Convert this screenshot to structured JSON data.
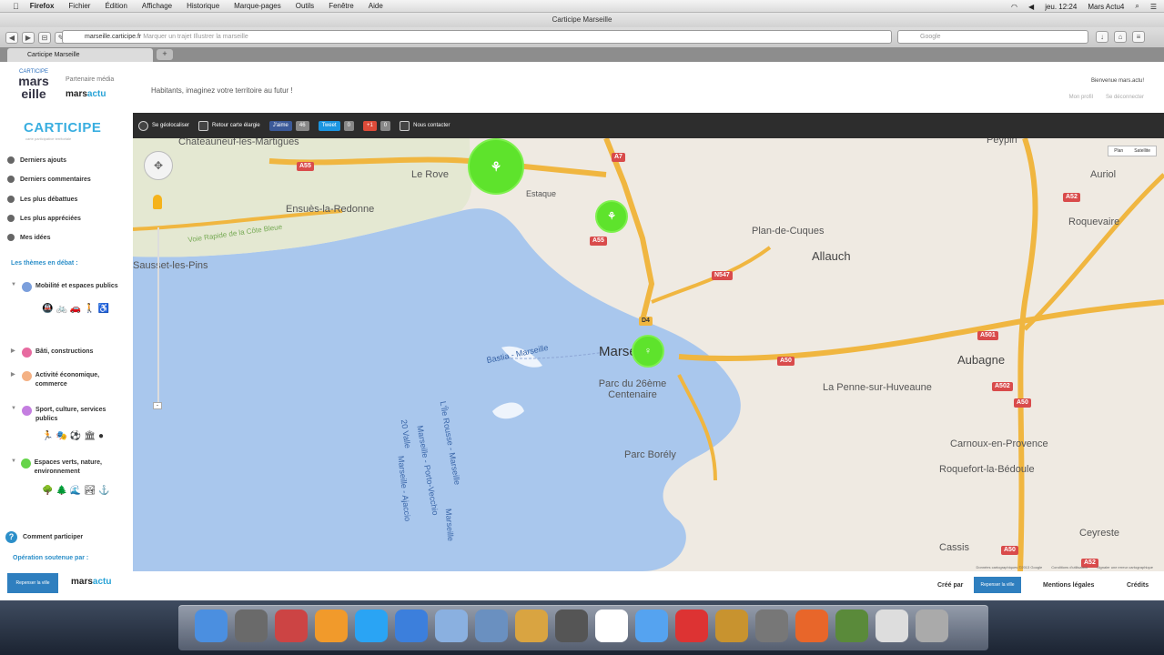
{
  "os_menubar": {
    "app": "Firefox",
    "menus": [
      "Fichier",
      "Édition",
      "Affichage",
      "Historique",
      "Marque-pages",
      "Outils",
      "Fenêtre",
      "Aide"
    ],
    "clock": "jeu. 12:24",
    "user": "Mars Actu4"
  },
  "browser": {
    "window_title": "Carticipe Marseille",
    "url_host": "marseille.carticipe.fr",
    "url_rest": " Marquer un trajet Illustrer la marseille",
    "search_engine": "Google",
    "tab_title": "Carticipe Marseille"
  },
  "header": {
    "logo_top": "CARTICIPE",
    "logo_main1": "mars",
    "logo_main2": "eille",
    "partner_label": "Partenaire média",
    "partner_name": "mars",
    "partner_name_accent": "actu",
    "tagline": "Habitants, imaginez votre territoire au futur !",
    "welcome": "Bienvenue mars.actu!",
    "user_links": [
      "Mon profil",
      "Se déconnecter"
    ]
  },
  "sidebar": {
    "brand": "CARTICIPE",
    "brand_sub": "carte participative territoriale",
    "nav": [
      "Derniers ajouts",
      "Derniers commentaires",
      "Les plus débattues",
      "Les plus appréciées",
      "Mes idées"
    ],
    "themes_title": "Les thèmes en débat :",
    "themes": [
      {
        "label": "Mobilité et espaces publics",
        "color": "#7b9fdc",
        "icons": "🚇🚲🚗🚶♿"
      },
      {
        "label": "Bâti, constructions",
        "color": "#e76ba0",
        "icons": ""
      },
      {
        "label": "Activité économique, commerce",
        "color": "#f4b184",
        "icons": ""
      },
      {
        "label": "Sport, culture, services publics",
        "color": "#c47ee0",
        "icons": "🏃🎭⚽🏛●"
      },
      {
        "label": "Espaces verts, nature, environnement",
        "color": "#66d44a",
        "icons": "🌳🌲🌊🏞⚓"
      }
    ],
    "help": "Comment participer",
    "support_label": "Opération soutenue par :",
    "footer_logo_text": "Repenser la ville",
    "footer_partner": "mars",
    "footer_partner_accent": "actu"
  },
  "map_toolbar": {
    "geoloc": "Se géolocaliser",
    "back": "Retour carte élargie",
    "like": "J'aime",
    "like_count": "46",
    "tweet": "Tweet",
    "tweet_count": "0",
    "gplus": "+1",
    "gplus_count": "0",
    "contact": "Nous contacter"
  },
  "map": {
    "maptype": [
      "Plan",
      "Satellite"
    ],
    "cities": [
      {
        "name": "Chateauneuf-les-Martigues",
        "cls": "city"
      },
      {
        "name": "Le Rove",
        "cls": "city"
      },
      {
        "name": "Ensuès-la-Redonne",
        "cls": "city"
      },
      {
        "name": "Sausset-les-Pins",
        "cls": "city"
      },
      {
        "name": "Estaque",
        "cls": "city"
      },
      {
        "name": "Plan-de-Cuques",
        "cls": "city"
      },
      {
        "name": "Allauch",
        "cls": "city mid"
      },
      {
        "name": "Roquevaire",
        "cls": "city"
      },
      {
        "name": "Auriol",
        "cls": "city"
      },
      {
        "name": "Peypin",
        "cls": "city"
      },
      {
        "name": "Marseille",
        "cls": "city big"
      },
      {
        "name": "Parc du 26ème Centenaire",
        "cls": "city"
      },
      {
        "name": "La Penne-sur-Huveaune",
        "cls": "city"
      },
      {
        "name": "Aubagne",
        "cls": "city mid"
      },
      {
        "name": "Parc Borély",
        "cls": "city"
      },
      {
        "name": "Carnoux-en-Provence",
        "cls": "city"
      },
      {
        "name": "Roquefort-la-Bédoule",
        "cls": "city"
      },
      {
        "name": "Cassis",
        "cls": "city"
      },
      {
        "name": "Ceyreste",
        "cls": "city"
      }
    ],
    "roads": [
      "A55",
      "A7",
      "A55",
      "N547",
      "D4",
      "A50",
      "A501",
      "A52",
      "A502",
      "A50",
      "A50",
      "A52"
    ],
    "road_label": "Voie Rapide de la Côte Bleue",
    "sea_labels": [
      "Bastia - Marseille",
      "L'Île Rousse - Marseille",
      "Marseille - Porto-Vecchio",
      "20 Valle",
      "Marseille - Ajaccio",
      "Marseille"
    ],
    "attribution": [
      "Données cartographiques ©2013 Google",
      "Conditions d'utilisation",
      "Signaler une erreur cartographique"
    ]
  },
  "footer": {
    "created_by": "Créé par",
    "created_logo": "Repenser la ville",
    "mentions": "Mentions légales",
    "credits": "Crédits"
  },
  "dock_colors": [
    "#4b8fe0",
    "#6a6a6a",
    "#c44",
    "#f19a2b",
    "#2aa4f4",
    "#3c7fdc",
    "#8ab0e0",
    "#6a90c0",
    "#d9a441",
    "#555",
    "#fff",
    "#55a3f0",
    "#d33",
    "#c8932f",
    "#777",
    "#e8662a",
    "#5a8a3a",
    "#ddd",
    "#aaa"
  ]
}
